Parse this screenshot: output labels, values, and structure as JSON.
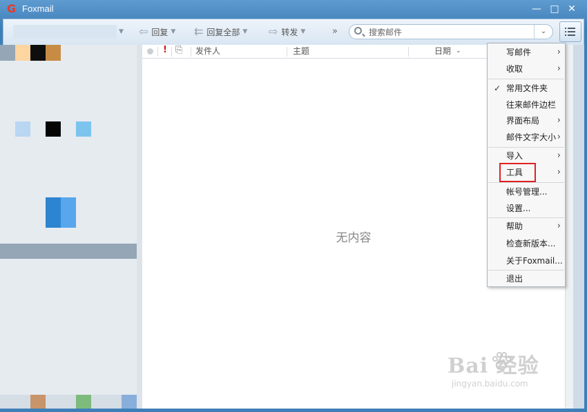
{
  "window": {
    "title": "Foxmail",
    "logo_letter": "G",
    "controls": {
      "minimize": "—",
      "maximize": "□",
      "close": "✕"
    }
  },
  "toolbar": {
    "reply_label": "回复",
    "reply_all_label": "回复全部",
    "forward_label": "转发",
    "more_label": "»"
  },
  "search": {
    "placeholder": "搜索邮件",
    "dropdown_glyph": "⌄"
  },
  "columns": {
    "exclaim": "!",
    "attach": "⌀",
    "sender": "发件人",
    "subject": "主题",
    "date": "日期"
  },
  "empty_state": "无内容",
  "menu": {
    "items": [
      {
        "label": "写邮件",
        "submenu": "›"
      },
      {
        "label": "收取",
        "submenu": "›"
      },
      {
        "label": "常用文件夹",
        "checked": "✓"
      },
      {
        "label": "往来邮件边栏"
      },
      {
        "label": "界面布局",
        "submenu": "›"
      },
      {
        "label": "邮件文字大小",
        "submenu": "›"
      },
      {
        "label": "导入",
        "submenu": "›"
      },
      {
        "label": "工具",
        "submenu": "›"
      },
      {
        "label": "帐号管理..."
      },
      {
        "label": "设置..."
      },
      {
        "label": "帮助",
        "submenu": "›"
      },
      {
        "label": "检查新版本..."
      },
      {
        "label": "关于Foxmail..."
      },
      {
        "label": "退出"
      }
    ]
  },
  "watermark": {
    "main": "Bai  经验",
    "sub": "jingyan.baidu.com"
  },
  "colors": {
    "titlebar": "#3f7fb8",
    "highlight_border": "#e02020",
    "menu_bg": "#f7f7f7"
  }
}
